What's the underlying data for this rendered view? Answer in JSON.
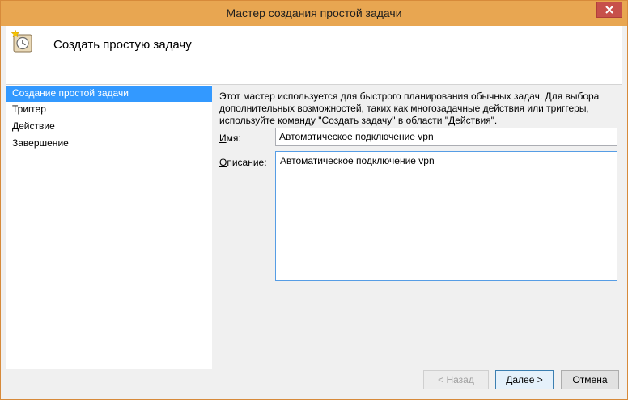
{
  "window": {
    "title": "Мастер создания простой задачи"
  },
  "header": {
    "title": "Создать простую задачу",
    "icon": "task-scheduler-clock-icon"
  },
  "nav": {
    "items": [
      {
        "label": "Создание простой задачи",
        "active": true
      },
      {
        "label": "Триггер",
        "active": false
      },
      {
        "label": "Действие",
        "active": false
      },
      {
        "label": "Завершение",
        "active": false
      }
    ]
  },
  "content": {
    "intro_lines": [
      "Этот мастер используется для быстрого планирования обычных задач.  Для выбора",
      "дополнительных возможностей, таких как многозадачные действия или триггеры,",
      "используйте команду \"Создать задачу\" в области \"Действия\"."
    ],
    "name_label_accel": "И",
    "name_label_rest": "мя:",
    "name_value": "Автоматическое подключение vpn",
    "desc_label_accel": "О",
    "desc_label_rest": "писание:",
    "desc_value": "Автоматическое подключение vpn"
  },
  "buttons": {
    "back": "< Назад",
    "next": "Далее >",
    "cancel": "Отмена"
  },
  "colors": {
    "titlebar": "#e8a651",
    "selection": "#3399ff",
    "close": "#c7504a"
  }
}
